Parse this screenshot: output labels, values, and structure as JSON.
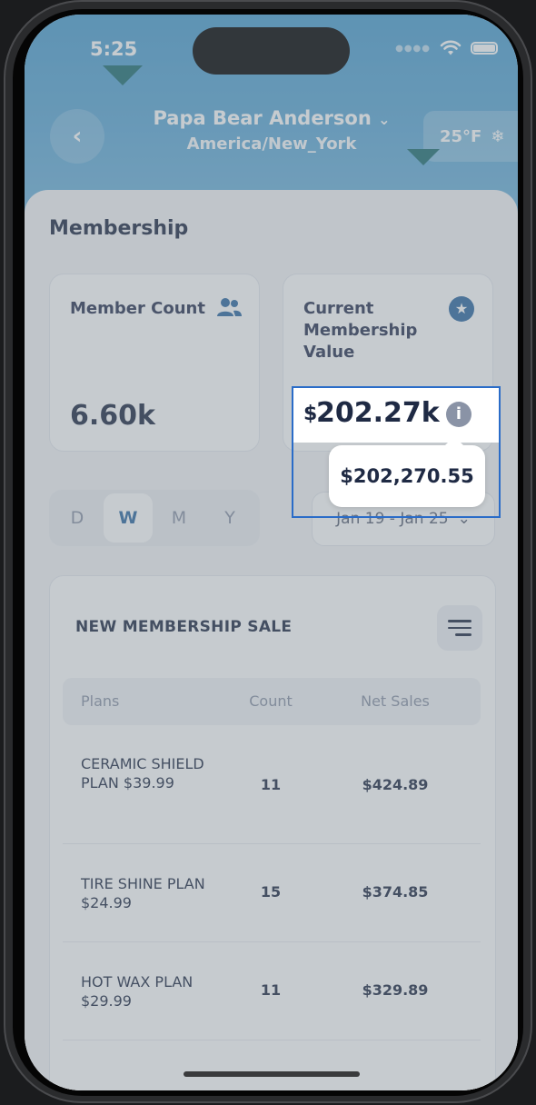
{
  "status": {
    "time": "5:25"
  },
  "header": {
    "name": "Papa Bear Anderson",
    "timezone": "America/New_York",
    "weather": "25°F"
  },
  "membership": {
    "section_title": "Membership",
    "member_count_label": "Member Count",
    "member_count_value": "6.60k",
    "current_value_label": "Current Membership Value",
    "current_value_currency": "$",
    "current_value_short": "202.27k",
    "tooltip_value": "$202,270.55"
  },
  "period_tabs": [
    "D",
    "W",
    "M",
    "Y"
  ],
  "active_tab": "W",
  "date_range": "Jan 19 - Jan 25",
  "table": {
    "title": "NEW MEMBERSHIP SALE",
    "headers": [
      "Plans",
      "Count",
      "Net Sales"
    ],
    "rows": [
      {
        "plan": "CERAMIC SHIELD PLAN $39.99",
        "count": "11",
        "net_sales": "$424.89"
      },
      {
        "plan": "TIRE SHINE PLAN $24.99",
        "count": "15",
        "net_sales": "$374.85"
      },
      {
        "plan": "HOT WAX PLAN $29.99",
        "count": "11",
        "net_sales": "$329.89"
      }
    ]
  }
}
